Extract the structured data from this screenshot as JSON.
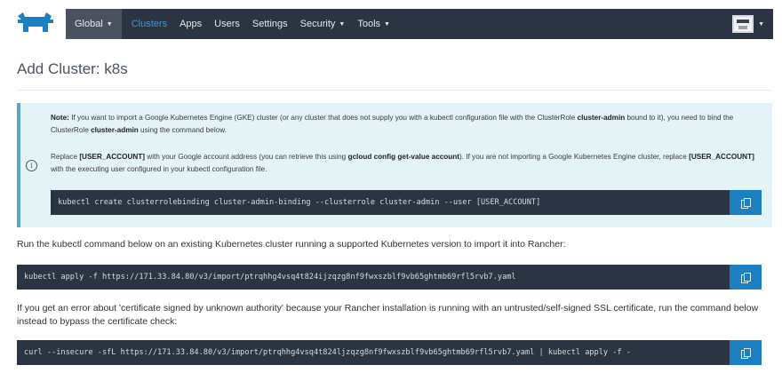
{
  "header": {
    "logo_icon": "rancher-cow-logo",
    "nav": {
      "global": "Global",
      "clusters": "Clusters",
      "apps": "Apps",
      "users": "Users",
      "settings": "Settings",
      "security": "Security",
      "tools": "Tools"
    },
    "active_item": "Clusters",
    "avatar_icon": "user-avatar-icon",
    "colors": {
      "navbar": "#2b3443",
      "active": "#3d98d3",
      "accent": "#1c7fc2"
    }
  },
  "page": {
    "title": "Add Cluster: k8s"
  },
  "note": {
    "icon": "info-icon",
    "label": "Note:",
    "p1_a": " If you want to import a Google Kubernetes Engine (GKE) cluster (or any cluster that does not supply you with a kubectl configuration file with the ClusterRole ",
    "p1_role": "cluster-admin",
    "p1_b": " bound to it), you need to bind the ClusterRole ",
    "p1_role2": "cluster-admin",
    "p1_c": " using the command below.",
    "p2_a": "Replace ",
    "p2_token": "[USER_ACCOUNT]",
    "p2_b": " with your Google account address (you can retrieve this using ",
    "p2_cmd": "gcloud config get-value account",
    "p2_c": "). If you are not importing a Google Kubernetes Engine cluster, replace ",
    "p2_token2": "[USER_ACCOUNT]",
    "p2_d": " with the executing user configured in your kubectl configuration file.",
    "command": "kubectl create clusterrolebinding cluster-admin-binding --clusterrole cluster-admin --user [USER_ACCOUNT]"
  },
  "import": {
    "instruction": "Run the kubectl command below on an existing Kubernetes cluster running a supported Kubernetes version to import it into Rancher:",
    "command": "kubectl apply -f https://171.33.84.80/v3/import/ptrqhhg4vsq4t824ijzqzg8nf9fwxszblf9vb65ghtmb69rfl5rvb7.yaml",
    "insecure_instruction": "If you get an error about 'certificate signed by unknown authority' because your Rancher installation is running with an untrusted/self-signed SSL certificate, run the command below instead to bypass the certificate check:",
    "insecure_command": "curl --insecure -sfL https://171.33.84.80/v3/import/ptrqhhg4vsq4t824ljzqzg8nf9fwxszblf9vb65ghtmb69rfl5rvb7.yaml | kubectl apply -f -"
  },
  "copy_icon": "copy-icon"
}
